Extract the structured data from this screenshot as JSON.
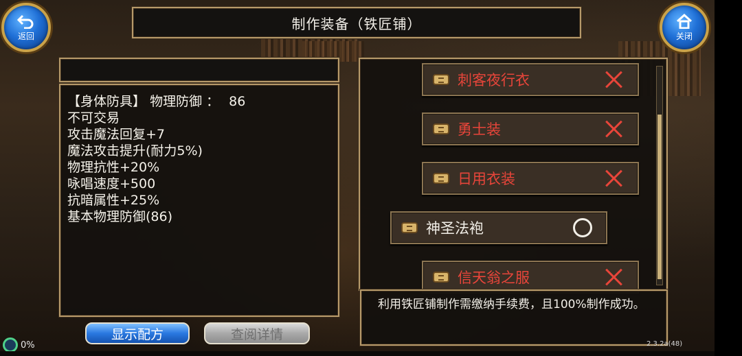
{
  "title": "制作装备（铁匠铺）",
  "back_button": {
    "label": "返回",
    "icon": "undo-arrow-icon"
  },
  "close_button": {
    "label": "关闭",
    "icon": "home-icon"
  },
  "details": {
    "category": "【身体防具】",
    "defense_label": "物理防御 ：",
    "defense_value": "86",
    "lines": [
      "不可交易",
      "攻击魔法回复+7",
      "魔法攻击提升(耐力5%)",
      "物理抗性+20%",
      "咏唱速度+500",
      "抗暗属性+25%",
      "基本物理防御(86)"
    ]
  },
  "recipes": [
    {
      "name": "刺客夜行衣",
      "status": "unavailable",
      "mark": "x-icon"
    },
    {
      "name": "勇士装",
      "status": "unavailable",
      "mark": "x-icon"
    },
    {
      "name": "日用衣装",
      "status": "unavailable",
      "mark": "x-icon"
    },
    {
      "name": "神圣法袍",
      "status": "available",
      "mark": "circle-icon"
    },
    {
      "name": "信天翁之服",
      "status": "unavailable",
      "mark": "x-icon"
    }
  ],
  "note": "利用铁匠铺制作需缴纳手续费，且100%制作成功。",
  "buttons": {
    "show_recipe": "显示配方",
    "view_details": "查阅详情"
  },
  "progress": "0%",
  "version": "2.3.2a(48)",
  "colors": {
    "unavailable": "#e8453a",
    "available": "#f2efe8",
    "accent_blue": "#2a78e0",
    "frame_gold": "#b79a6a"
  }
}
